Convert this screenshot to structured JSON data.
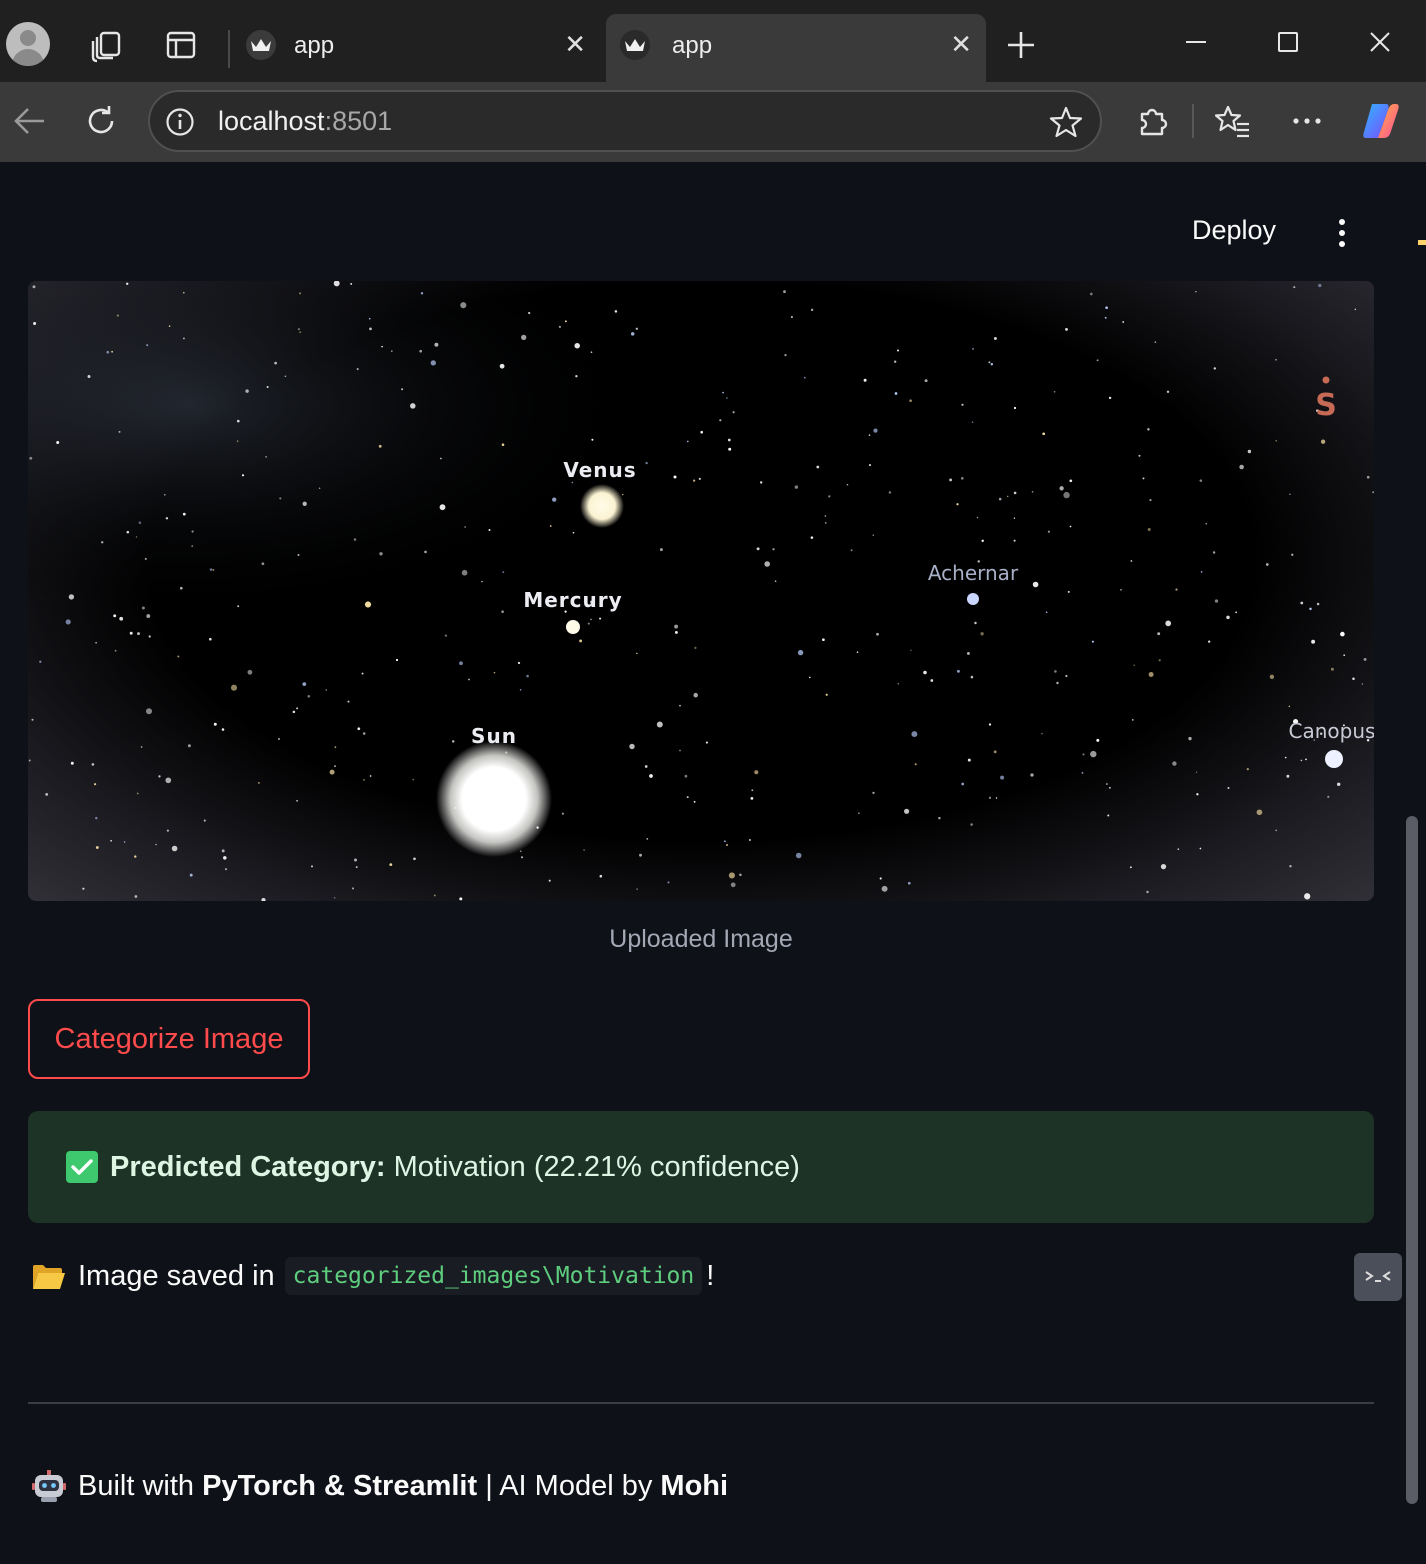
{
  "browser": {
    "tabs": [
      {
        "label": "app",
        "active": false
      },
      {
        "label": "app",
        "active": true
      }
    ],
    "url_host": "localhost",
    "url_port": ":8501"
  },
  "header": {
    "deploy_label": "Deploy"
  },
  "sky_labels": {
    "venus": "Venus",
    "mercury": "Mercury",
    "sun": "Sun",
    "achernar": "Achernar",
    "canopus": "Canopus",
    "compass": "S"
  },
  "image": {
    "caption": "Uploaded Image"
  },
  "actions": {
    "categorize_label": "Categorize Image"
  },
  "result": {
    "label": "Predicted Category:",
    "value": "Motivation (22.21% confidence)",
    "accent": "#3ec96e"
  },
  "saved": {
    "prefix": "Image saved in",
    "path": "categorized_images\\Motivation",
    "suffix": "!"
  },
  "footer": {
    "prefix": "Built with",
    "tech": "PyTorch & Streamlit",
    "middle": "| AI Model by",
    "author": "Mohi"
  },
  "colors": {
    "primary": "#ff4b4b",
    "background": "#0e1117",
    "success_bg": "#1d3325",
    "code_text": "#5ece7e"
  }
}
